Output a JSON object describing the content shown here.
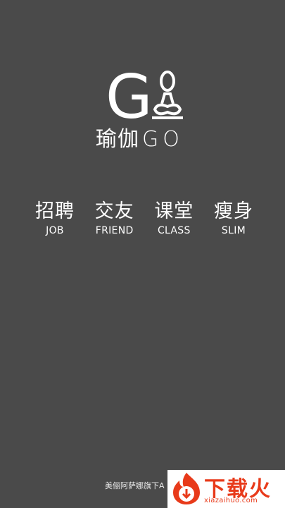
{
  "brand": {
    "logo_letter": "G",
    "name_cn": "瑜伽",
    "name_en": "GO"
  },
  "features": [
    {
      "cn": "招聘",
      "en": "JOB"
    },
    {
      "cn": "交友",
      "en": "FRIEND"
    },
    {
      "cn": "课堂",
      "en": "CLASS"
    },
    {
      "cn": "瘦身",
      "en": "SLIM"
    }
  ],
  "footer": {
    "text": "美俪阿萨娜旗下A"
  },
  "watermark": {
    "name_cn": "下载火",
    "url": "xiazaihuo.com",
    "color": "#e83a1a"
  },
  "colors": {
    "background": "#4a4a4a",
    "text": "#ffffff"
  }
}
